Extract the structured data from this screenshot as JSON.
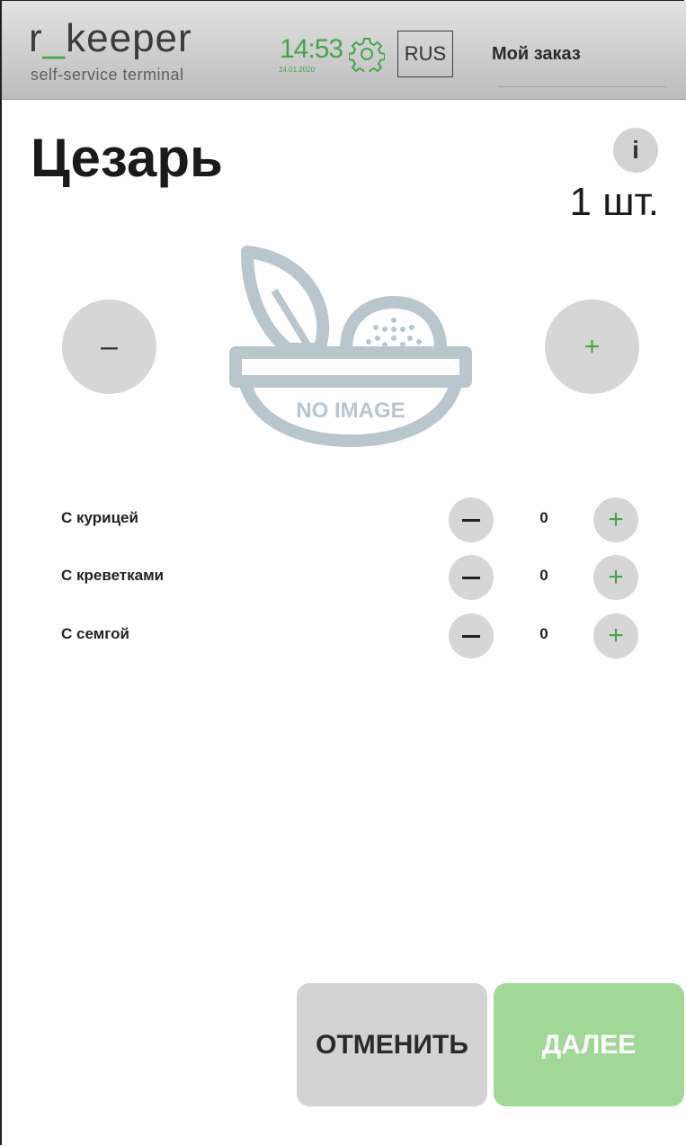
{
  "header": {
    "logo_main_prefix": "r",
    "logo_main_underscore": "_",
    "logo_main_suffix": "keeper",
    "logo_sub": "self-service terminal",
    "time": "14:53",
    "date": "24.01.2020",
    "settings_icon": "gear-icon",
    "language": "RUS",
    "my_order": "Мой заказ"
  },
  "product": {
    "title": "Цезарь",
    "info_label": "i",
    "quantity": "1 шт.",
    "minus_label": "–",
    "plus_label": "+",
    "image_placeholder": "NO IMAGE"
  },
  "modifiers": [
    {
      "label": "С курицей",
      "count": "0"
    },
    {
      "label": "С креветками",
      "count": "0"
    },
    {
      "label": "С семгой",
      "count": "0"
    }
  ],
  "modifier_plus": "+",
  "actions": {
    "cancel": "ОТМЕНИТЬ",
    "next": "ДАЛЕЕ"
  },
  "colors": {
    "accent": "#46a44a",
    "next_button": "#a1d797",
    "button_gray": "#d6d6d6"
  }
}
